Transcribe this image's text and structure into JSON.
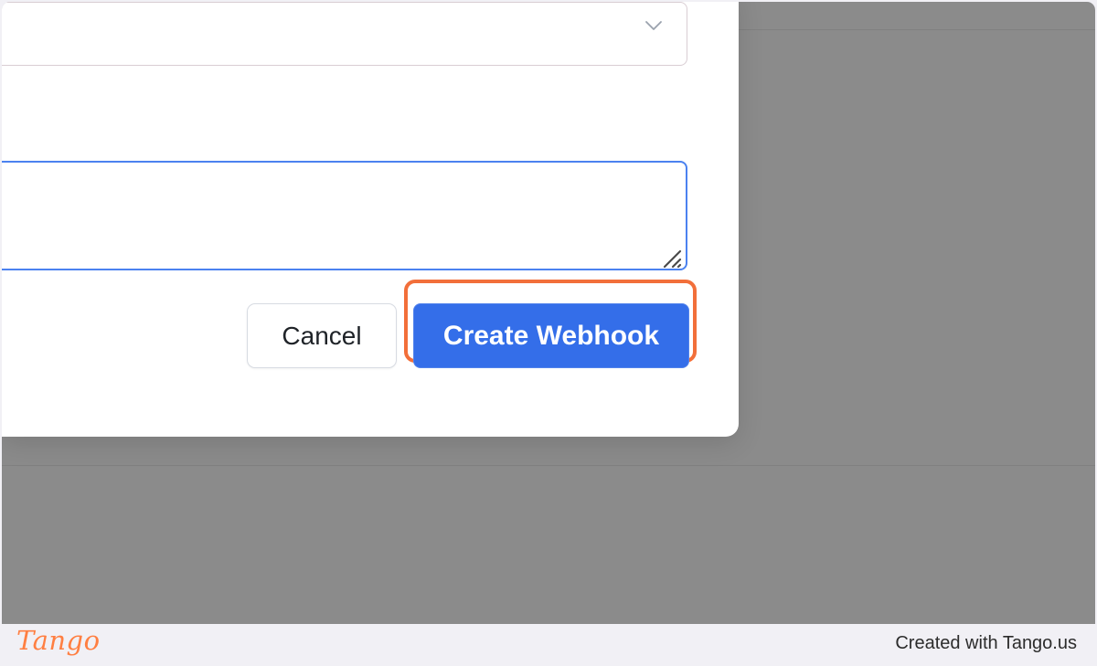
{
  "form": {
    "select_icon": "chevron-down-icon",
    "textarea_value": "",
    "resize_icon": "resize-handle-icon"
  },
  "buttons": {
    "cancel_label": "Cancel",
    "create_label": "Create Webhook"
  },
  "colors": {
    "overlay": "#8b8b8b",
    "primary": "#346ee9",
    "highlight": "#f26f3a",
    "brand": "#ff7f42",
    "footer": "#f1f0f5"
  },
  "footer": {
    "brand_logo": "Tango",
    "credit_text": "Created with Tango.us"
  }
}
